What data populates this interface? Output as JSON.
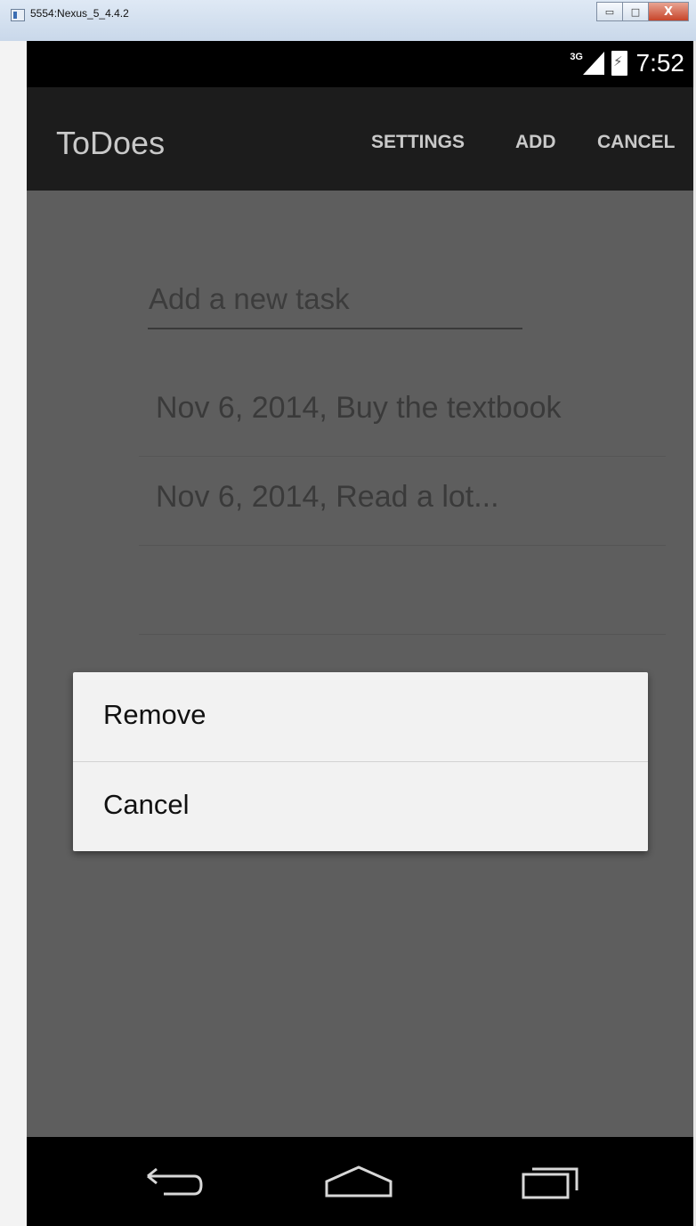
{
  "window": {
    "title": "5554:Nexus_5_4.4.2",
    "minimize_glyph": "▭",
    "maximize_glyph": "□",
    "close_glyph": "X"
  },
  "statusbar": {
    "network": "3G",
    "time": "7:52"
  },
  "actionbar": {
    "title": "ToDoes",
    "settings_label": "SETTINGS",
    "add_label": "ADD",
    "cancel_label": "CANCEL"
  },
  "input": {
    "placeholder": "Add a new task"
  },
  "tasks": [
    {
      "text": "Nov 6, 2014, Buy the textbook"
    },
    {
      "text": "Nov 6, 2014, Read a lot..."
    },
    {
      "text": ""
    }
  ],
  "dialog": {
    "remove_label": "Remove",
    "cancel_label": "Cancel"
  },
  "navbar": {
    "icons": [
      "back-icon",
      "home-icon",
      "recent-apps-icon"
    ]
  },
  "colors": {
    "screen_dim": "#5e5e5e",
    "actionbar": "#1c1c1c",
    "dialog_bg": "#f2f2f2"
  }
}
